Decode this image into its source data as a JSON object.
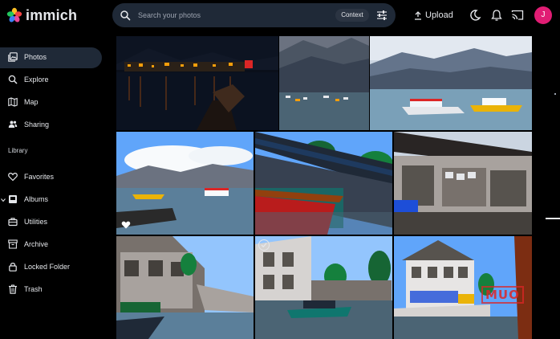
{
  "app": {
    "name": "immich"
  },
  "search": {
    "placeholder": "Search your photos",
    "context_label": "Context"
  },
  "toolbar": {
    "upload_label": "Upload",
    "avatar_initial": "J"
  },
  "sidebar": {
    "items": [
      {
        "label": "Photos",
        "icon": "photos-icon",
        "active": true
      },
      {
        "label": "Explore",
        "icon": "explore-icon"
      },
      {
        "label": "Map",
        "icon": "map-icon"
      },
      {
        "label": "Sharing",
        "icon": "sharing-icon"
      }
    ],
    "library_label": "Library",
    "library_items": [
      {
        "label": "Favorites",
        "icon": "heart-icon"
      },
      {
        "label": "Albums",
        "icon": "album-icon"
      },
      {
        "label": "Utilities",
        "icon": "toolbox-icon"
      },
      {
        "label": "Archive",
        "icon": "archive-icon"
      },
      {
        "label": "Locked Folder",
        "icon": "lock-icon"
      },
      {
        "label": "Trash",
        "icon": "trash-icon"
      }
    ]
  },
  "watermark": "MUO",
  "colors": {
    "accent": "#e5e7eb",
    "active_bg": "#1f2937",
    "avatar": "#e11d74"
  }
}
